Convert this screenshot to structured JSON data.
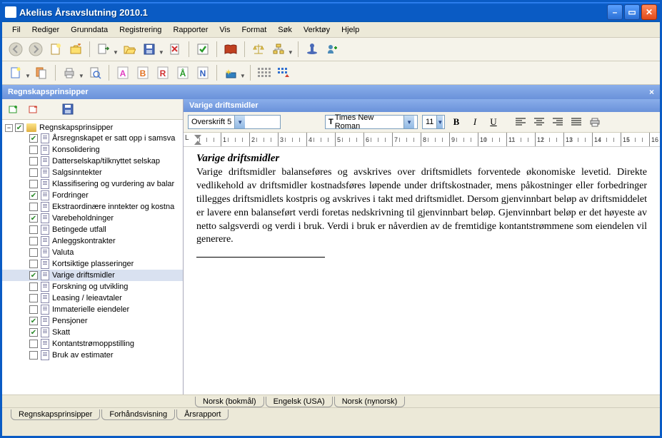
{
  "window": {
    "title": "Akelius Årsavslutning 2010.1"
  },
  "menus": [
    "Fil",
    "Rediger",
    "Grunndata",
    "Registrering",
    "Rapporter",
    "Vis",
    "Format",
    "Søk",
    "Verktøy",
    "Hjelp"
  ],
  "left_panel_title": "Regnskapsprinsipper",
  "tree_root": {
    "label": "Regnskapsprinsipper",
    "checked": true
  },
  "tree_items": [
    {
      "label": "Årsregnskapet er satt opp i samsva",
      "checked": true
    },
    {
      "label": "Konsolidering",
      "checked": false
    },
    {
      "label": "Datterselskap/tilknyttet selskap",
      "checked": false
    },
    {
      "label": "Salgsinntekter",
      "checked": false
    },
    {
      "label": "Klassifisering og vurdering av balar",
      "checked": false
    },
    {
      "label": "Fordringer",
      "checked": true
    },
    {
      "label": "Ekstraordinære inntekter og kostna",
      "checked": false
    },
    {
      "label": "Varebeholdninger",
      "checked": true
    },
    {
      "label": "Betingede utfall",
      "checked": false
    },
    {
      "label": "Anleggskontrakter",
      "checked": false
    },
    {
      "label": "Valuta",
      "checked": false
    },
    {
      "label": "Kortsiktige plasseringer",
      "checked": false
    },
    {
      "label": "Varige driftsmidler",
      "checked": true,
      "selected": true
    },
    {
      "label": "Forskning og utvikling",
      "checked": false
    },
    {
      "label": "Leasing / leieavtaler",
      "checked": false
    },
    {
      "label": "Immaterielle eiendeler",
      "checked": false
    },
    {
      "label": "Pensjoner",
      "checked": true
    },
    {
      "label": "Skatt",
      "checked": true
    },
    {
      "label": "Kontantstrømoppstilling",
      "checked": false
    },
    {
      "label": "Bruk av estimater",
      "checked": false
    }
  ],
  "editor": {
    "title": "Varige driftsmidler",
    "style": "Overskrift 5",
    "font": "Times New Roman",
    "size": "11",
    "heading": "Varige driftsmidler",
    "body": "Varige driftsmidler balanseføres og avskrives over driftsmidlets forventede økonomiske levetid. Direkte vedlikehold av driftsmidler kostnadsføres løpende under driftskostnader, mens påkostninger eller forbedringer tillegges driftsmidlets kostpris og avskrives i takt med driftsmidlet. Dersom gjenvinnbart beløp av driftsmiddelet er lavere enn balanseført verdi foretas nedskrivning til gjenvinnbart beløp. Gjenvinnbart beløp er det høyeste av netto salgsverdi og verdi i bruk. Verdi i bruk er nåverdien av de fremtidige kontantstrømmene som eiendelen vil generere."
  },
  "lang_tabs": [
    "Norsk (bokmål)",
    "Engelsk (USA)",
    "Norsk (nynorsk)"
  ],
  "main_tabs": [
    "Regnskapsprinsipper",
    "Forhåndsvisning",
    "Årsrapport"
  ],
  "ruler_marks": [
    1,
    2,
    3,
    4,
    5,
    6,
    7,
    8,
    9,
    10,
    11,
    12,
    13,
    14,
    15,
    16
  ]
}
